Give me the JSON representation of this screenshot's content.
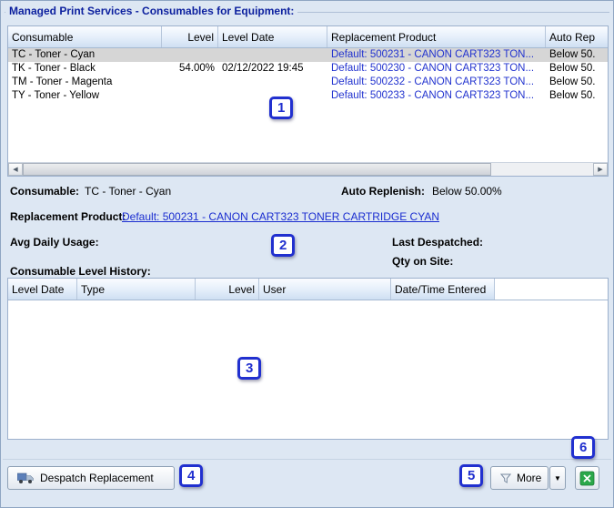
{
  "title": "Managed Print Services - Consumables for Equipment:",
  "consumables_table": {
    "columns": [
      "Consumable",
      "Level",
      "Level Date",
      "Replacement Product",
      "Auto Rep"
    ],
    "rows": [
      {
        "consumable": "TC - Toner - Cyan",
        "level": "",
        "level_date": "",
        "replacement": "Default: 500231 - CANON CART323 TON...",
        "auto_replenish": "Below 50."
      },
      {
        "consumable": "TK - Toner - Black",
        "level": "54.00%",
        "level_date": "02/12/2022 19:45",
        "replacement": "Default: 500230 - CANON CART323 TON...",
        "auto_replenish": "Below 50."
      },
      {
        "consumable": "TM - Toner - Magenta",
        "level": "",
        "level_date": "",
        "replacement": "Default: 500232 - CANON CART323 TON...",
        "auto_replenish": "Below 50."
      },
      {
        "consumable": "TY - Toner - Yellow",
        "level": "",
        "level_date": "",
        "replacement": "Default: 500233 - CANON CART323 TON...",
        "auto_replenish": "Below 50."
      }
    ]
  },
  "details": {
    "consumable_label": "Consumable:",
    "consumable_value": "TC - Toner - Cyan",
    "auto_replenish_label": "Auto Replenish:",
    "auto_replenish_value": "Below 50.00%",
    "replacement_product_label": "Replacement Product:",
    "replacement_product_link": "Default: 500231 - CANON CART323 TONER CARTRIDGE CYAN",
    "avg_daily_usage_label": "Avg Daily Usage:",
    "last_despatched_label": "Last Despatched:",
    "qty_on_site_label": "Qty on Site:"
  },
  "history": {
    "label": "Consumable Level History:",
    "columns": [
      "Level Date",
      "Type",
      "Level",
      "User",
      "Date/Time Entered"
    ]
  },
  "footer": {
    "despatch_label": "Despatch Replacement",
    "more_label": "More"
  },
  "icons": {
    "scroll_left": "◀",
    "scroll_right": "▶",
    "dropdown": "▼"
  },
  "annotations": [
    "1",
    "2",
    "3",
    "4",
    "5",
    "6"
  ]
}
